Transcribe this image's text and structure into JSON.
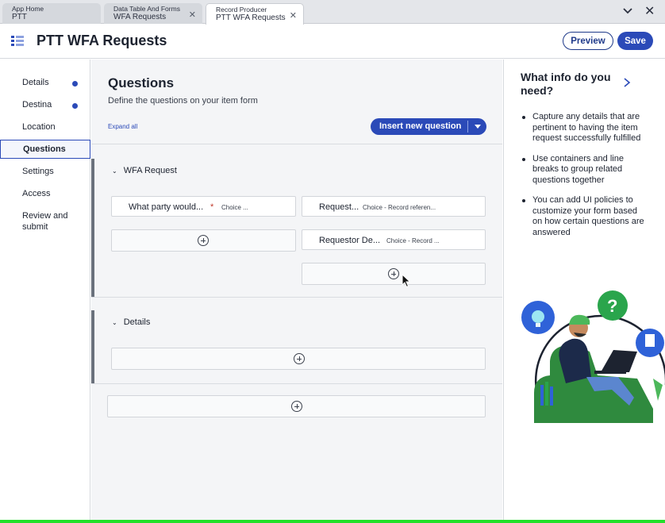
{
  "tabs": [
    {
      "line1": "App Home",
      "line2": "PTT",
      "closable": false
    },
    {
      "line1": "Data Table And Forms",
      "line2": "WFA Requests",
      "closable": true
    },
    {
      "line1": "Record Producer",
      "line2": "PTT WFA Requests",
      "closable": true,
      "active": true
    }
  ],
  "header": {
    "title": "PTT WFA Requests",
    "preview_label": "Preview",
    "save_label": "Save"
  },
  "nav": {
    "items": [
      {
        "label": "Details",
        "indicator": true
      },
      {
        "label": "Destina",
        "indicator": true
      },
      {
        "label": "Location",
        "indicator": false
      },
      {
        "label": "Questions",
        "indicator": false,
        "active": true
      },
      {
        "label": "Settings",
        "indicator": false
      },
      {
        "label": "Access",
        "indicator": false
      },
      {
        "label": "Review and submit",
        "indicator": false
      }
    ]
  },
  "main": {
    "title": "Questions",
    "subtitle": "Define the questions on your item form",
    "expand_all": "Expand all",
    "insert_label": "Insert new question",
    "sections": [
      {
        "name": "WFA Request",
        "questions": [
          {
            "label": "What party would...",
            "required": true,
            "required_mark": "*",
            "type": "Choice ..."
          },
          {
            "label": "Request...",
            "required": false,
            "type": "Choice - Record referen..."
          },
          {
            "label": "Requestor De...",
            "required": false,
            "type": "Choice - Record ..."
          }
        ]
      },
      {
        "name": "Details",
        "questions": []
      }
    ]
  },
  "info_panel": {
    "title": "What info do you need?",
    "tips": [
      "Capture any details that are pertinent to having the item request successfully fulfilled",
      "Use containers and line breaks to group related questions together",
      "You can add UI policies to customize your form based on how certain questions are answered"
    ]
  },
  "colors": {
    "accent": "#2b4ab8",
    "required": "#c0392b",
    "bottom_bar": "#22e02a"
  }
}
